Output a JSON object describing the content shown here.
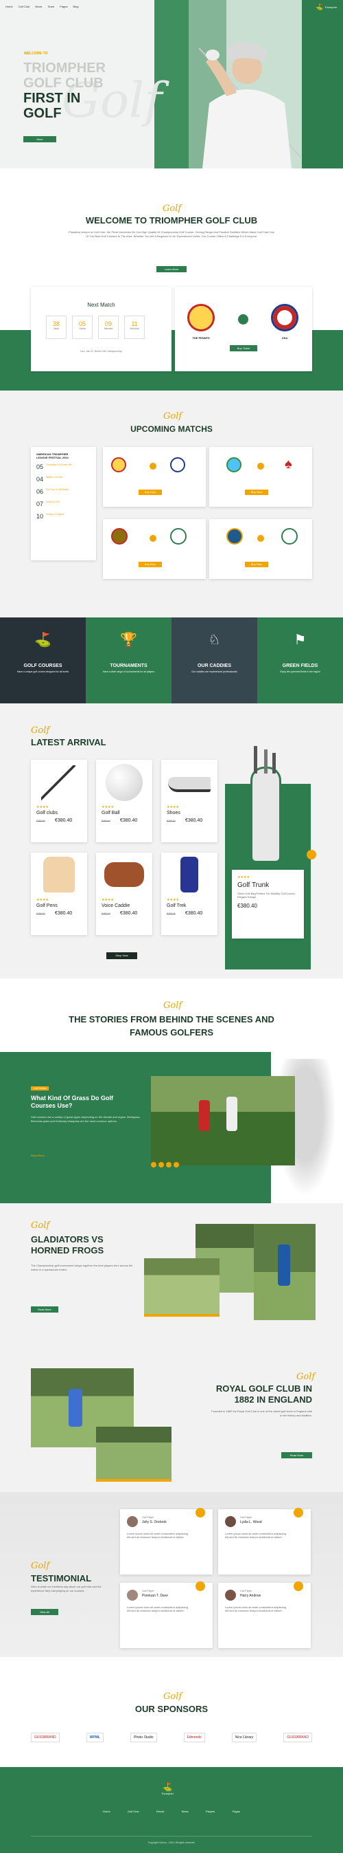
{
  "nav": {
    "items": [
      "Home",
      "Golf Club",
      "News",
      "Team",
      "Pages",
      "Blog"
    ],
    "logo": "Triumpher"
  },
  "hero": {
    "kicker": "WELCOME TO",
    "title1": "TRIOMPHER",
    "title2": "GOLF CLUB",
    "title3": "FIRST IN",
    "title4": "GOLF",
    "button": "More"
  },
  "welcome": {
    "title": "WELCOME TO TRIOMPHER GOLF CLUB",
    "text": "Phasellus tempor at Golf Club. We Pride Ourselves On Our High Quality Of Championship Golf Course, Driving Range And Practice Facilities Which Make Golf Club One Of The Best Golf Courses In The Area. Whether You Are A Beginner Or An Experienced Golfer, Our Course Offers A Challenge For Everyone.",
    "button": "Learn More"
  },
  "next_match": {
    "title": "Next Match",
    "counts": [
      {
        "num": "38",
        "lbl": "Days"
      },
      {
        "num": "05",
        "lbl": "Hours"
      },
      {
        "num": "09",
        "lbl": "Minutes"
      },
      {
        "num": "11",
        "lbl": "Seconds"
      }
    ],
    "date": "Nov, Jan 22, World Golf Championship",
    "team1": "THE PENNFS",
    "team2": "USA",
    "button": "Buy Ticket"
  },
  "upcoming": {
    "title": "UPCOMING MATCHS",
    "script": "Golf",
    "list_title": "AMERICAN TRIUMPHER LEAGUE FESTIVAL 2024",
    "list": [
      {
        "day": "05",
        "txt": "Triumpher Vs Green Hill"
      },
      {
        "day": "04",
        "txt": "Mexico Vs Club"
      },
      {
        "day": "06",
        "txt": "Hot Cup Vs Wellness"
      },
      {
        "day": "07",
        "txt": "Club Vs Golf"
      },
      {
        "day": "10",
        "txt": "Victory Vs Tigers"
      }
    ],
    "button": "Buy Now"
  },
  "services": [
    {
      "title": "GOLF COURSES",
      "text": "Have a unique golf course designed for all levels"
    },
    {
      "title": "TOURNAMENTS",
      "text": "Have a wide range of tournaments for all players"
    },
    {
      "title": "OUR CADDIES",
      "text": "Our caddies are experienced professionals"
    },
    {
      "title": "GREEN FIELDS",
      "text": "Enjoy the greenest fields in the region"
    }
  ],
  "arrival": {
    "script": "Golf",
    "title": "LATEST ARRIVAL",
    "products": [
      {
        "name": "Golf clubs",
        "old": "€255.00",
        "price": "€380.40"
      },
      {
        "name": "Golf Ball",
        "old": "€255.00",
        "price": "€380.40"
      },
      {
        "name": "Shoes",
        "old": "€255.00",
        "price": "€380.40"
      },
      {
        "name": "Golf Pens",
        "old": "€255.00",
        "price": "€380.40"
      },
      {
        "name": "Voice Caddie",
        "old": "€255.00",
        "price": "€380.40"
      },
      {
        "name": "Golf Trek",
        "old": "€255.00",
        "price": "€380.40"
      }
    ],
    "featured": {
      "name": "Golf Trunk",
      "text": "Other Golf Bag Perfect For Mobility Golf Lovers. Elegant Design",
      "price": "€380.40"
    },
    "button": "Shop Now"
  },
  "stories": {
    "script": "Golf",
    "title1": "THE STORIES FROM BEHIND THE SCENES AND",
    "title2": "FAMOUS GOLFERS",
    "tag": "Golf Stories",
    "post_title": "What Kind Of Grass Do Golf Courses Use?",
    "post_text": "Golf courses use a variety of grass types depending on the climate and region. Bentgrass, Bermuda grass and Kentucky bluegrass are the most common options.",
    "link": "Read More"
  },
  "gladiators": {
    "script": "Golf",
    "title1": "GLADIATORS VS",
    "title2": "HORNED FROGS",
    "text": "The Championship golf tournament brings together the best players from across the nation in a spectacular match.",
    "button": "Read More"
  },
  "royal": {
    "script": "Golf",
    "title1": "ROYAL GOLF CLUB IN",
    "title2": "1882 IN ENGLAND",
    "text": "Founded in 1882 the Royal Golf Club is one of the oldest golf clubs in England with a rich history and tradition.",
    "button": "Read More"
  },
  "testimonial": {
    "script": "Golf",
    "title": "TESTIMONIAL",
    "text": "Here is what our members say about our golf club and the experience they had playing on our courses.",
    "button": "View All",
    "items": [
      {
        "name": "Jelly S. Orebrok",
        "role": "Golf Player",
        "text": "Lorem ipsum dolor sit amet consectetur adipiscing elit sed do eiusmod tempor incididunt ut labore."
      },
      {
        "name": "Lydia L. Wood",
        "role": "Golf Player",
        "text": "Lorem ipsum dolor sit amet consectetur adipiscing elit sed do eiusmod tempor incididunt ut labore."
      },
      {
        "name": "Pinetuan T. Dave",
        "role": "Golf Player",
        "text": "Lorem ipsum dolor sit amet consectetur adipiscing elit sed do eiusmod tempor incididunt ut labore."
      },
      {
        "name": "Harry Andrew",
        "role": "Golf Player",
        "text": "Lorem ipsum dolor sit amet consectetur adipiscing elit sed do eiusmod tempor incididunt ut labore."
      }
    ]
  },
  "sponsors": {
    "script": "Golf",
    "title": "OUR SPONSORS",
    "items": [
      "GUSSBRAND",
      "WPML",
      "Photo Studio",
      "Edmonds",
      "Nice Library",
      "GUSSBRAND"
    ]
  },
  "footer": {
    "logo": "Triumpher",
    "links": [
      "Home",
      "Golf Club",
      "Result",
      "News",
      "Players",
      "Pages"
    ],
    "copyright": "Copyright Gofxon - 2024. All rights reserved."
  }
}
